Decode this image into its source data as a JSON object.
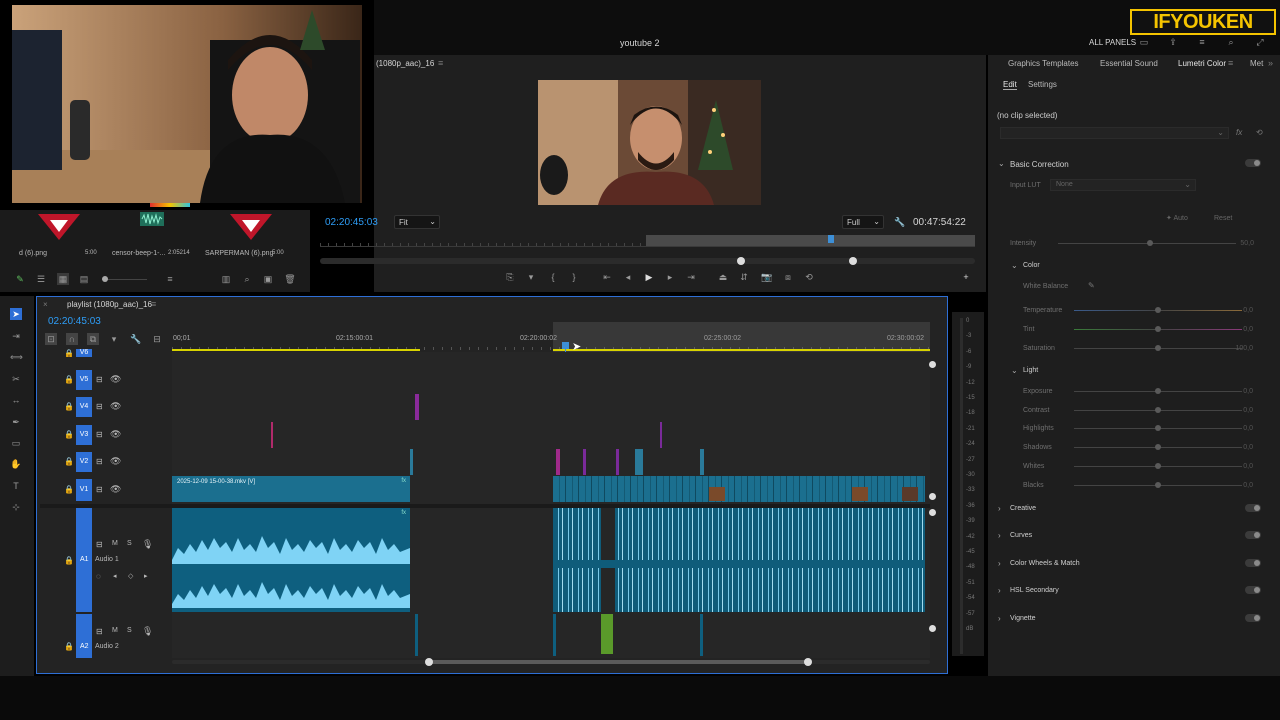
{
  "app": {
    "project_title": "youtube 2",
    "all_panels_label": "ALL PANELS",
    "brand_watermark": "IFYOUKEN"
  },
  "colors": {
    "accent_blue": "#2e9df6",
    "track_blue": "#1b6f8f",
    "audio_wave": "#7fd3f5",
    "playhead": "#3d8fd6",
    "brand_yellow": "#f5c400"
  },
  "project_bin": {
    "items": [
      {
        "name": "d (6).png",
        "duration": "5:00"
      },
      {
        "name": "censor-beep-1-...",
        "duration": "2:05214"
      },
      {
        "name": "SARPERMAN (6).png",
        "duration": "5:00"
      }
    ]
  },
  "program_monitor": {
    "sequence_label": "(1080p_aac)_16",
    "current_timecode": "02:20:45:03",
    "fit_select": "Fit",
    "quality_select": "Full",
    "duration_timecode": "00:47:54:22"
  },
  "timeline": {
    "sequence_tab": "playlist (1080p_aac)_16",
    "timecode": "02:20:45:03",
    "ruler_labels": [
      "00;01",
      "02:15:00:01",
      "02:20:00:02",
      "02:25:00:02",
      "02:30:00:02"
    ],
    "video_tracks": [
      "V6",
      "V5",
      "V4",
      "V3",
      "V2",
      "V1"
    ],
    "audio_tracks": [
      {
        "id": "A1",
        "name": "Audio 1"
      },
      {
        "id": "A2",
        "name": "Audio 2"
      }
    ],
    "clip_v1_label": "2025-12-09 15-00-38.mkv [V]",
    "meter_labels": [
      "0",
      "-3",
      "-6",
      "-9",
      "-12",
      "-15",
      "-18",
      "-21",
      "-24",
      "-27",
      "-30",
      "-33",
      "-36",
      "-39",
      "-42",
      "-45",
      "-48",
      "-51",
      "-54",
      "-57",
      "dB"
    ]
  },
  "right_panel": {
    "tabs": [
      "Graphics Templates",
      "Essential Sound",
      "Lumetri Color",
      "Met"
    ],
    "subtabs": [
      "Edit",
      "Settings"
    ],
    "no_clip": "(no clip selected)",
    "basic_correction": "Basic Correction",
    "input_lut_label": "Input LUT",
    "input_lut_value": "None",
    "auto_label": "Auto",
    "reset_label": "Reset",
    "intensity_label": "Intensity",
    "intensity_value": "50,0",
    "color_section": "Color",
    "white_balance": "White Balance",
    "color_props": [
      {
        "label": "Temperature",
        "value": "0,0"
      },
      {
        "label": "Tint",
        "value": "0,0"
      },
      {
        "label": "Saturation",
        "value": "100,0"
      }
    ],
    "light_section": "Light",
    "light_props": [
      {
        "label": "Exposure",
        "value": "0,0"
      },
      {
        "label": "Contrast",
        "value": "0,0"
      },
      {
        "label": "Highlights",
        "value": "0,0"
      },
      {
        "label": "Shadows",
        "value": "0,0"
      },
      {
        "label": "Whites",
        "value": "0,0"
      },
      {
        "label": "Blacks",
        "value": "0,0"
      }
    ],
    "collapsed_sections": [
      "Creative",
      "Curves",
      "Color Wheels & Match",
      "HSL Secondary",
      "Vignette"
    ]
  }
}
